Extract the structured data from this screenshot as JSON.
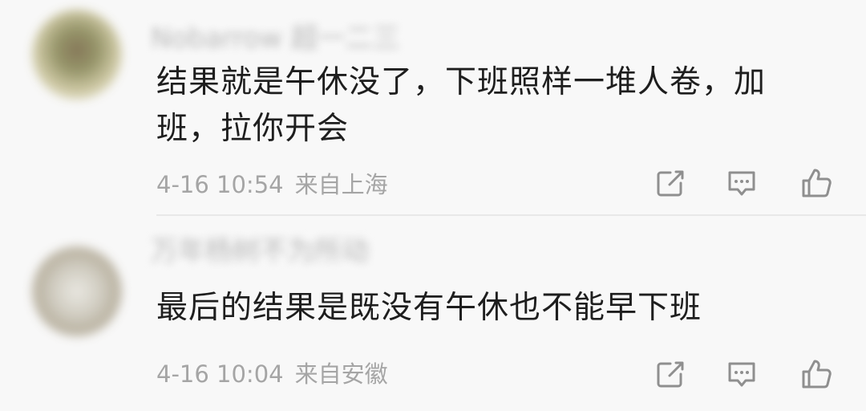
{
  "comments": [
    {
      "username": "Nobarrow 超一二三",
      "text": "结果就是午休没了，下班照样一堆人卷，加班，拉你开会",
      "date": "4-16 10:54",
      "location": "来自上海",
      "icons": {
        "share": "share-icon",
        "reply": "comment-icon",
        "like": "thumbs-up-icon"
      }
    },
    {
      "username": "万年杨树不为所动",
      "text": "最后的结果是既没有午休也不能早下班",
      "date": "4-16 10:04",
      "location": "来自安徽",
      "icons": {
        "share": "share-icon",
        "reply": "comment-icon",
        "like": "thumbs-up-icon"
      }
    }
  ],
  "colors": {
    "background": "#f8f8f8",
    "text": "#1e1e1e",
    "meta": "#a5a5a5",
    "icon": "#8f8f8f",
    "divider": "#e8e8e8"
  }
}
